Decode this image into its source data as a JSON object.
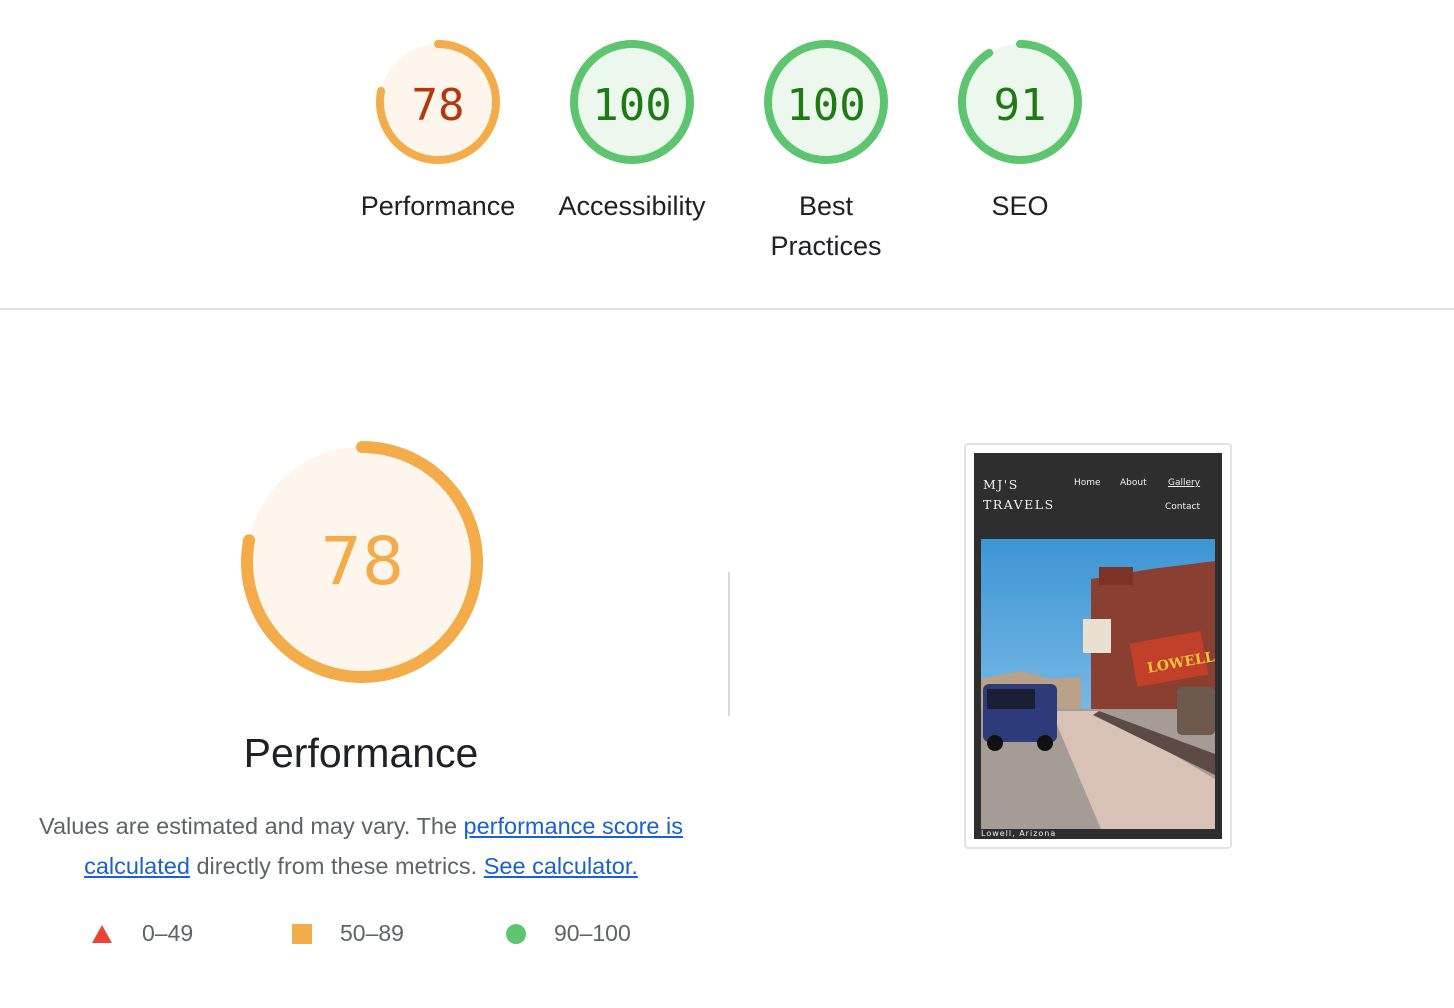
{
  "colors": {
    "average_stroke": "#f4ab4a",
    "average_fill": "#fef6ec",
    "average_text": "#b3380d",
    "pass_stroke": "#5dc46f",
    "pass_fill": "#ecf8ee",
    "pass_text": "#1f7a16",
    "fail": "#eb4335",
    "link": "#1a5fd6"
  },
  "categories": [
    {
      "label": "Performance",
      "score": "78",
      "fraction": 0.78,
      "rating": "average"
    },
    {
      "label": "Accessibility",
      "score": "100",
      "fraction": 1.0,
      "rating": "pass"
    },
    {
      "label": "Best Practices",
      "score": "100",
      "fraction": 1.0,
      "rating": "pass"
    },
    {
      "label": "SEO",
      "score": "91",
      "fraction": 0.91,
      "rating": "pass"
    }
  ],
  "performance": {
    "score": "78",
    "fraction": 0.78,
    "title": "Performance",
    "note_text_1": "Values are estimated and may vary. The ",
    "note_link_1": "performance score is calculated",
    "note_text_2": " directly from these metrics. ",
    "note_link_2": "See calculator."
  },
  "legend": [
    {
      "icon": "triangle-icon",
      "label": "0–49"
    },
    {
      "icon": "square-icon",
      "label": "50–89"
    },
    {
      "icon": "circle-icon",
      "label": "90–100"
    }
  ],
  "screenshot": {
    "site_title_line1": "MJ'S",
    "site_title_line2": "TRAVELS",
    "nav": [
      "Home",
      "About",
      "Gallery",
      "Contact"
    ],
    "caption": "Lowell, Arizona",
    "sign_text": "LOWELL"
  }
}
